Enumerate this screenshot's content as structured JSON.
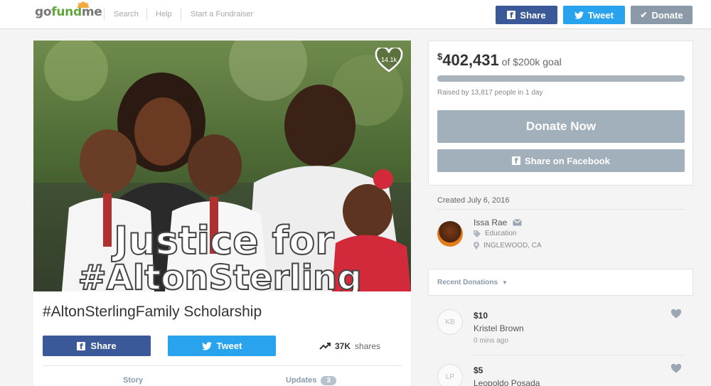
{
  "header": {
    "logo_go": "go",
    "logo_fund": "fund",
    "logo_me": "me",
    "nav": [
      "Search",
      "Help",
      "Start a Fundraiser"
    ],
    "share_label": "Share",
    "tweet_label": "Tweet",
    "donate_label": "Donate"
  },
  "campaign": {
    "heart_count": "14.1k",
    "title": "#AltonSterlingFamily Scholarship",
    "share_label": "Share",
    "tweet_label": "Tweet",
    "shares_count": "37K",
    "shares_label": "shares",
    "tabs": {
      "story": "Story",
      "updates": "Updates",
      "updates_count": "3"
    },
    "image_text_line1": "Justice for",
    "image_text_line2": "#AltonSterling"
  },
  "goal": {
    "currency": "$",
    "amount": "402,431",
    "goal_text": "of $200k goal",
    "progress_fraction": 1.0,
    "raised_by": "Raised by 13,817 people in 1 day",
    "donate_now": "Donate Now",
    "share_facebook": "Share on Facebook"
  },
  "organizer": {
    "created": "Created July 6, 2016",
    "name": "Issa Rae",
    "category": "Education",
    "location": "INGLEWOOD, CA"
  },
  "recent": {
    "label": "Recent Donations",
    "items": [
      {
        "initials": "KB",
        "amount": "$10",
        "name": "Kristel Brown",
        "time": "0 mins ago"
      },
      {
        "initials": "LP",
        "amount": "$5",
        "name": "Leopoldo Posada",
        "time": ""
      }
    ]
  },
  "colors": {
    "facebook": "#3b5998",
    "twitter": "#2aa3ef",
    "muted_button": "#8a9aa8",
    "logo_green": "#60a83c"
  }
}
